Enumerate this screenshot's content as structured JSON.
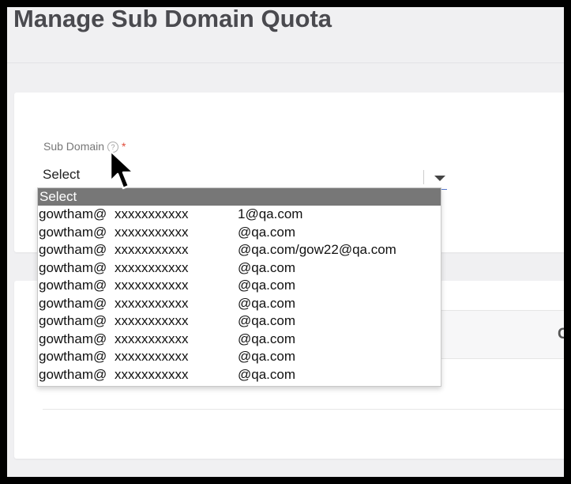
{
  "page": {
    "title": "Manage Sub Domain Quota"
  },
  "form": {
    "sub_domain": {
      "label": "Sub Domain",
      "help_glyph": "?",
      "required_mark": "*",
      "value": "Select"
    }
  },
  "dropdown": {
    "selected_label": "Select",
    "options": [
      {
        "user": "gowtham@",
        "masked": "xxxxxxxxxxx",
        "domain": "1@qa.com"
      },
      {
        "user": "gowtham@",
        "masked": "xxxxxxxxxxx",
        "domain": "@qa.com"
      },
      {
        "user": "gowtham@",
        "masked": "xxxxxxxxxxx",
        "domain": "@qa.com/gow22@qa.com"
      },
      {
        "user": "gowtham@",
        "masked": "xxxxxxxxxxx",
        "domain": "@qa.com"
      },
      {
        "user": "gowtham@",
        "masked": "xxxxxxxxxxx",
        "domain": "@qa.com"
      },
      {
        "user": "gowtham@",
        "masked": "xxxxxxxxxxx",
        "domain": "@qa.com"
      },
      {
        "user": "gowtham@",
        "masked": "xxxxxxxxxxx",
        "domain": "@qa.com"
      },
      {
        "user": "gowtham@",
        "masked": "xxxxxxxxxxx",
        "domain": "@qa.com"
      },
      {
        "user": "gowtham@",
        "masked": "xxxxxxxxxxx",
        "domain": "@qa.com"
      },
      {
        "user": "gowtham@",
        "masked": "xxxxxxxxxxx",
        "domain": "@qa.com"
      }
    ]
  },
  "table": {
    "header_partial": "C"
  },
  "icons": {
    "cursor": "mouse-pointer-icon",
    "help": "help-circle-icon",
    "caret": "caret-down-icon"
  },
  "colors": {
    "title": "#4a4a4f",
    "required": "#e04b3a",
    "selected_option_bg": "#777777",
    "focus_underline": "#5577cc"
  }
}
